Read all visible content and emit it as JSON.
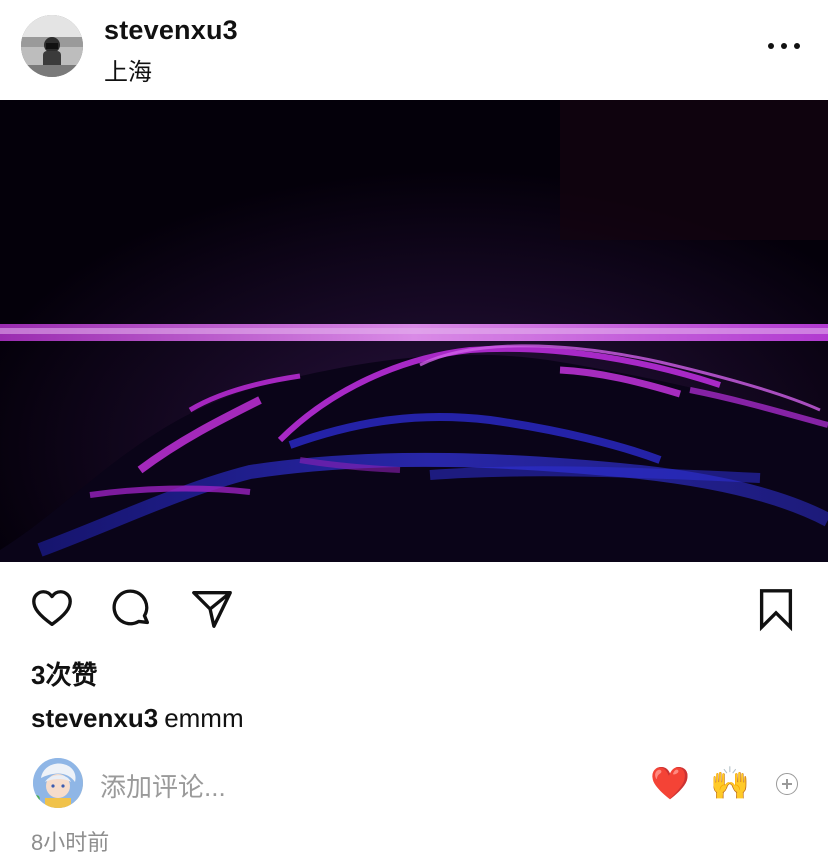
{
  "post": {
    "username": "stevenxu3",
    "location": "上海",
    "likes_text": "3次赞",
    "caption_user": "stevenxu3",
    "caption_text": "emmm",
    "time_text": "8小时前"
  },
  "comment": {
    "placeholder": "添加评论...",
    "emoji_1": "❤️",
    "emoji_2": "🙌"
  },
  "icons": {
    "more": "more-horizontal-icon",
    "like": "heart-icon",
    "comment": "comment-bubble-icon",
    "share": "paper-plane-icon",
    "save": "bookmark-icon",
    "add": "plus-circle-icon"
  },
  "colors": {
    "text": "#111111",
    "muted": "#8e8e8e",
    "photo_bg": "#04000a",
    "neon_magenta": "#c02bd8",
    "neon_blue": "#2a2bd0"
  }
}
